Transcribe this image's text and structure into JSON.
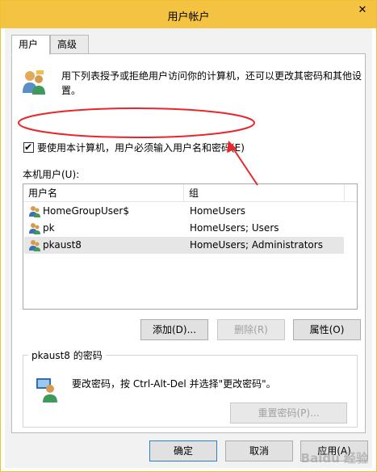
{
  "window": {
    "title": "用户帐户",
    "close_glyph": "✕"
  },
  "tabs": [
    {
      "label": "用户",
      "active": true
    },
    {
      "label": "高级",
      "active": false
    }
  ],
  "intro_text": "用下列表授予或拒绝用户访问你的计算机，还可以更改其密码和其他设置。",
  "must_login_checkbox": {
    "label": "要使用本计算机，用户必须输入用户名和密码(E)",
    "checked": true
  },
  "local_users": {
    "label": "本机用户(U):",
    "columns": [
      "用户名",
      "组"
    ],
    "rows": [
      {
        "name": "HomeGroupUser$",
        "group": "HomeUsers",
        "selected": false
      },
      {
        "name": "pk",
        "group": "HomeUsers; Users",
        "selected": false
      },
      {
        "name": "pkaust8",
        "group": "HomeUsers; Administrators",
        "selected": true
      }
    ]
  },
  "buttons": {
    "add": "添加(D)...",
    "remove": "删除(R)",
    "properties": "属性(O)",
    "reset_password": "重置密码(P)...",
    "ok": "确定",
    "cancel": "取消",
    "apply": "应用(A)"
  },
  "password_group": {
    "title": "pkaust8 的密码",
    "text": "要改密码，按 Ctrl-Alt-Del 并选择\"更改密码\"。"
  },
  "watermark": "Baidu 经验",
  "colors": {
    "titlebar": "#f5c342",
    "annotation": "#e8262b",
    "selected_row": "#e6e6e6"
  },
  "icons": [
    "users-icon",
    "user-icon",
    "password-icon",
    "close-icon",
    "check-icon"
  ]
}
